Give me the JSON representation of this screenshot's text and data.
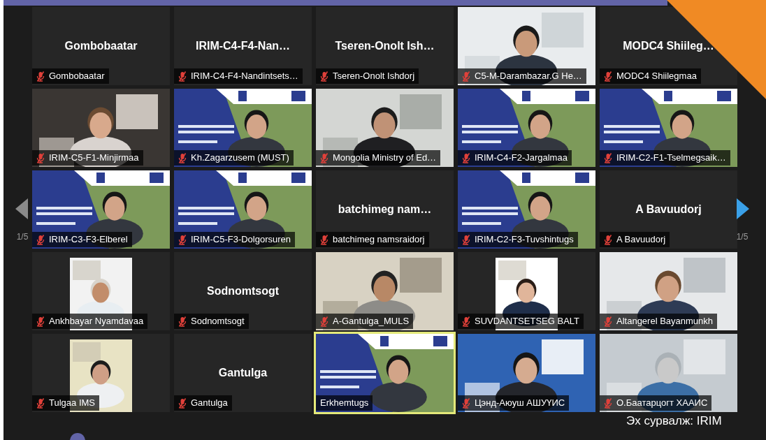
{
  "participants": [
    {
      "kind": "name",
      "display_name": "Gombobaatar",
      "label": "Gombobaatar",
      "muted": true,
      "speaking": false
    },
    {
      "kind": "name",
      "display_name": "IRIM-C4-F4-Nan…",
      "label": "IRIM-C4-F4-Nandintsets…",
      "muted": true,
      "speaking": false
    },
    {
      "kind": "name",
      "display_name": "Tseren-Onolt Ish…",
      "label": "Tseren-Onolt Ishdorj",
      "muted": true,
      "speaking": false
    },
    {
      "kind": "video",
      "label": "C5-M-Darambazar.G He…",
      "muted": true,
      "speaking": false
    },
    {
      "kind": "name",
      "display_name": "MODC4 Shiileg…",
      "label": "MODC4 Shiilegmaa",
      "muted": true,
      "speaking": false
    },
    {
      "kind": "video",
      "label": "IRIM-C5-F1-Minjirmaa",
      "muted": true,
      "speaking": false
    },
    {
      "kind": "slide",
      "label": "Kh.Zagarzusem (MUST)",
      "muted": true,
      "speaking": false
    },
    {
      "kind": "video",
      "label": "Mongolia Ministry of Ed…",
      "muted": true,
      "speaking": false
    },
    {
      "kind": "slide",
      "label": "IRIM-C4-F2-Jargalmaa",
      "muted": true,
      "speaking": false
    },
    {
      "kind": "slide",
      "label": "IRIM-C2-F1-Tselmegsaik…",
      "muted": true,
      "speaking": false
    },
    {
      "kind": "slide",
      "label": "IRIM-C3-F3-Elberel",
      "muted": true,
      "speaking": false
    },
    {
      "kind": "slide",
      "label": "IRIM-C5-F3-Dolgorsuren",
      "muted": true,
      "speaking": false
    },
    {
      "kind": "name",
      "display_name": "batchimeg nam…",
      "label": "batchimeg namsraidorj",
      "muted": true,
      "speaking": false
    },
    {
      "kind": "slide",
      "label": "IRIM-C2-F3-Tuvshintugs",
      "muted": true,
      "speaking": false
    },
    {
      "kind": "name",
      "display_name": "A Bavuudorj",
      "label": "A Bavuudorj",
      "muted": true,
      "speaking": false
    },
    {
      "label": "Ankhbayar Nyamdavaa",
      "muted": true,
      "speaking": false
    },
    {
      "kind": "name",
      "display_name": "Sodnomtsogt",
      "label": "Sodnomtsogt",
      "muted": true,
      "speaking": false
    },
    {
      "kind": "video",
      "label": "A-Gantulga_MULS",
      "muted": true,
      "speaking": false
    },
    {
      "label": "SUVDANTSETSEG BALT",
      "muted": true,
      "speaking": false
    },
    {
      "kind": "video",
      "label": "Altangerel Bayanmunkh",
      "muted": true,
      "speaking": false
    },
    {
      "label": "Tulgaa IMS",
      "muted": true,
      "speaking": false
    },
    {
      "kind": "name",
      "display_name": "Gantulga",
      "label": "Gantulga",
      "muted": true,
      "speaking": false
    },
    {
      "kind": "slide",
      "label": "Erkhemtugs",
      "muted": false,
      "speaking": true
    },
    {
      "kind": "video",
      "label": "Цэнд-Аюуш АШУҮИС",
      "muted": true,
      "speaking": false
    },
    {
      "kind": "video",
      "label": "О.Баатарцогт ХААИС",
      "muted": true,
      "speaking": false
    }
  ],
  "pager": {
    "left_page": "1/5",
    "right_page": "1/5"
  },
  "caption": "Эх сурвалж: IRIM"
}
